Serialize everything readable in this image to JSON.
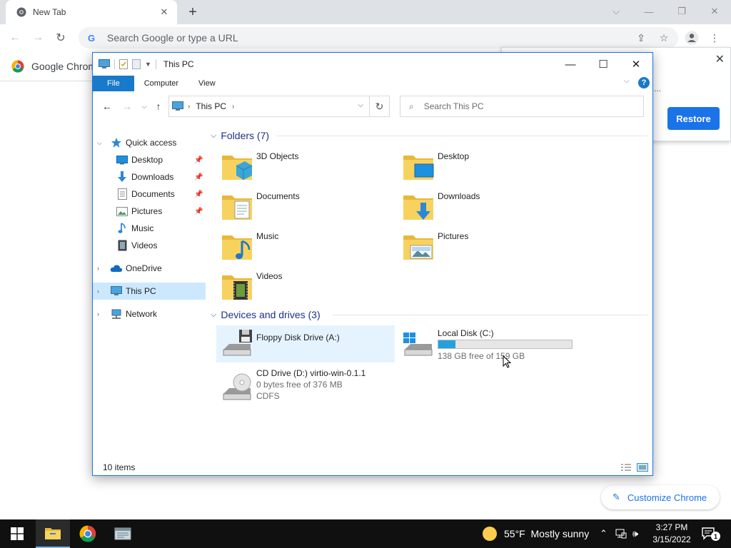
{
  "chrome": {
    "tab_title": "New Tab",
    "omnibox_placeholder": "Search Google or type a URL",
    "bookmark_label": "Google Chrome",
    "restore_text": "...",
    "restore_button": "Restore",
    "customize_label": "Customize Chrome"
  },
  "explorer": {
    "window_title": "This PC",
    "ribbon_tabs": [
      "File",
      "Computer",
      "View"
    ],
    "address_location": "This PC",
    "search_placeholder": "Search This PC",
    "status_items": "10 items",
    "nav": {
      "quick_access": "Quick access",
      "quick_items": [
        "Desktop",
        "Downloads",
        "Documents",
        "Pictures",
        "Music",
        "Videos"
      ],
      "onedrive": "OneDrive",
      "this_pc": "This PC",
      "network": "Network"
    },
    "folders_header": "Folders (7)",
    "folders": [
      "3D Objects",
      "Desktop",
      "Documents",
      "Downloads",
      "Music",
      "Pictures",
      "Videos"
    ],
    "drives_header": "Devices and drives (3)",
    "drives": {
      "floppy": {
        "name": "Floppy Disk Drive (A:)"
      },
      "local": {
        "name": "Local Disk (C:)",
        "free": "138 GB free of 159 GB",
        "used_fraction": 0.13
      },
      "cd": {
        "name": "CD Drive (D:) virtio-win-0.1.1",
        "free": "0 bytes free of 376 MB",
        "fs": "CDFS"
      }
    }
  },
  "taskbar": {
    "weather": "55°F  Mostly sunny",
    "time": "3:27 PM",
    "date": "3/15/2022",
    "notification_count": "1"
  },
  "colors": {
    "accent": "#1979ca",
    "chrome_blue": "#1a73e8",
    "drive_fill": "#26a0da",
    "folder": "#f4c542",
    "taskbar": "#101010"
  }
}
